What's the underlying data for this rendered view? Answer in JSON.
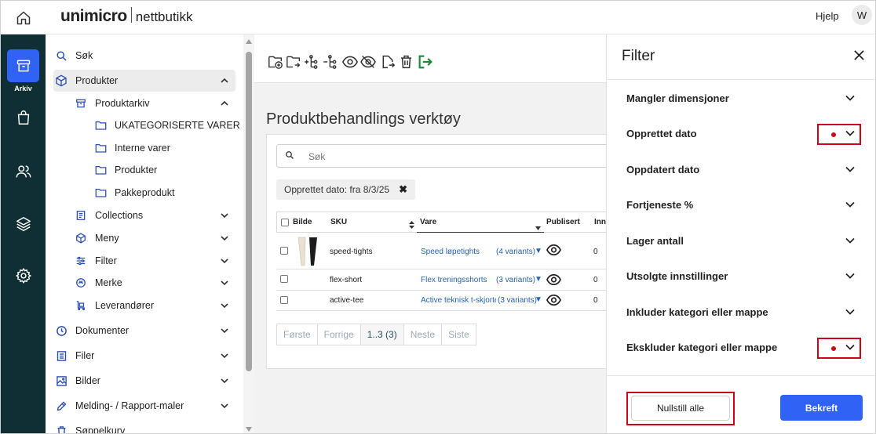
{
  "header": {
    "brand": "unimicro",
    "brand_sub": "nettbutikk",
    "help": "Hjelp",
    "avatar_initial": "W"
  },
  "rail": {
    "active_label": "Arkiv",
    "icons": [
      "archive-icon",
      "shopping-bag-icon",
      "users-icon",
      "layers-icon",
      "settings-icon"
    ]
  },
  "nav": {
    "items": [
      {
        "label": "Søk"
      },
      {
        "label": "Produkter"
      },
      {
        "label": "Produktarkiv"
      },
      {
        "label": "UKATEGORISERTE VARER"
      },
      {
        "label": "Interne varer"
      },
      {
        "label": "Produkter"
      },
      {
        "label": "Pakkeprodukt"
      },
      {
        "label": "Collections"
      },
      {
        "label": "Meny"
      },
      {
        "label": "Filter"
      },
      {
        "label": "Merke"
      },
      {
        "label": "Leverandører"
      },
      {
        "label": "Dokumenter"
      },
      {
        "label": "Filer"
      },
      {
        "label": "Bilder"
      },
      {
        "label": "Melding- / Rapport-maler"
      },
      {
        "label": "Søppelkurv"
      }
    ]
  },
  "main": {
    "title": "Produktbehandlings verktøy",
    "search_placeholder": "Søk",
    "active_filter_chip": "Opprettet dato: fra 8/3/25",
    "chip_remove": "✖",
    "columns": [
      "Bilde",
      "SKU",
      "Vare",
      "Publisert",
      "Inn"
    ],
    "rows": [
      {
        "sku": "speed-tights",
        "name": "Speed løpetights",
        "variants": "(4 variants)",
        "stock": "0"
      },
      {
        "sku": "flex-short",
        "name": "Flex treningsshorts",
        "variants": "(3 variants)",
        "stock": "0"
      },
      {
        "sku": "active-tee",
        "name": "Active teknisk t-skjorte",
        "variants": "(3 variants)",
        "stock": "0"
      }
    ],
    "pagination": {
      "first": "Første",
      "prev": "Forrige",
      "current": "1..3 (3)",
      "next": "Neste",
      "last": "Siste"
    }
  },
  "filter": {
    "title": "Filter",
    "sections": [
      {
        "label": "Mangler dimensjoner",
        "active": false
      },
      {
        "label": "Opprettet dato",
        "active": true
      },
      {
        "label": "Oppdatert dato",
        "active": false
      },
      {
        "label": "Fortjeneste %",
        "active": false
      },
      {
        "label": "Lager antall",
        "active": false
      },
      {
        "label": "Utsolgte innstillinger",
        "active": false
      },
      {
        "label": "Inkluder kategori eller mappe",
        "active": false
      },
      {
        "label": "Ekskluder kategori eller mappe",
        "active": true
      }
    ],
    "reset_label": "Nullstill alle",
    "confirm_label": "Bekreft"
  },
  "colors": {
    "rail_bg": "#0f2f35",
    "accent": "#2f62f5",
    "highlight": "#d0021b",
    "link": "#2563b6",
    "toolbar_green": "#138a36"
  }
}
